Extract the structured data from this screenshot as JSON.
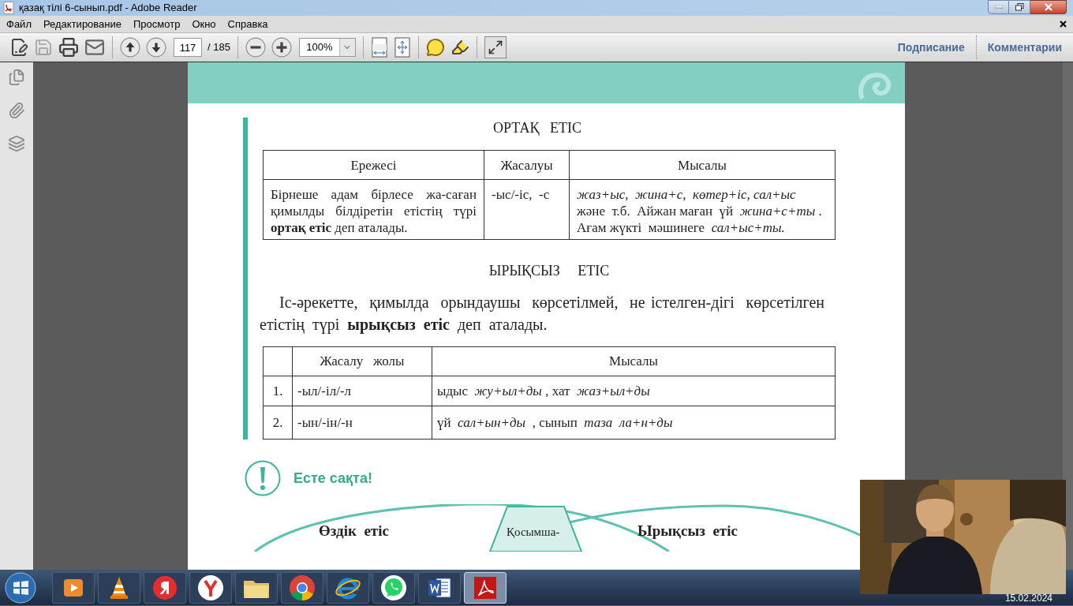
{
  "window": {
    "title": "қазақ тілі 6-сынып.pdf - Adobe Reader"
  },
  "menu": [
    "Файл",
    "Редактирование",
    "Просмотр",
    "Окно",
    "Справка"
  ],
  "toolbar": {
    "groups": [
      {
        "tools": [
          {
            "kind": "edit",
            "disabled": false
          },
          {
            "kind": "save",
            "disabled": true
          },
          {
            "kind": "print",
            "disabled": false
          },
          {
            "kind": "mail",
            "disabled": false
          }
        ]
      },
      {
        "tools": [
          {
            "kind": "up",
            "disabled": false
          },
          {
            "kind": "down",
            "disabled": false
          }
        ],
        "page": "117",
        "page_total": "/ 185"
      },
      {
        "tools": [
          {
            "kind": "zoom-out",
            "disabled": false
          },
          {
            "kind": "zoom-in",
            "disabled": false
          }
        ],
        "zoom": "100%"
      },
      {
        "tools": [
          {
            "kind": "fit-width",
            "disabled": false
          },
          {
            "kind": "fit-page",
            "disabled": false
          }
        ]
      },
      {
        "tools": [
          {
            "kind": "comment",
            "disabled": false
          },
          {
            "kind": "highlight",
            "disabled": false
          }
        ]
      },
      {
        "tools": [
          {
            "kind": "fullscreen",
            "disabled": false
          }
        ]
      }
    ],
    "links": [
      "Подписание",
      "Комментарии"
    ]
  },
  "document": {
    "heading1": "ОРТАҚ   ЕТІС",
    "table1": {
      "columns": [
        "Ережесі",
        "Жасалуы",
        "Мысалы"
      ],
      "rows": [
        [
          "Бірнеше адам бірлесе жа-саған қимылды білдіретін етістің түрі **ортақ етіс** деп аталады.",
          "-ыс/-іс,  -с",
          "*жаз+ыс,  жина+с,  көтер+іс, сал+ыс*  және  т.б.  Айжан маған  үй  *жина+с+ты* . Ағам жүкті  мәшинеге  *сал+ыс+ты.*"
        ]
      ]
    },
    "heading2": "ЫРЫҚСЫЗ     ЕТІС",
    "paragraph": "Іс-әрекетте,  қимылда  орындаушы  көрсетілмей,  не істелген-дігі  көрсетілген   етістің  түрі  **ырықсыз  етіс**  деп  аталады.",
    "table2": {
      "columns": [
        "",
        "Жасалу   жолы",
        "Мысалы"
      ],
      "rows": [
        [
          "1.",
          "-ыл/-іл/-л",
          "ыдыс  *жу+ыл+ды* , хат  *жаз+ыл+ды*"
        ],
        [
          "2.",
          "-ын/-ін/-н",
          "үй  *сал+ын+ды*  , сынып  *таза  ла+н+ды*"
        ]
      ]
    },
    "note": "Есте сақта!",
    "diagram": {
      "left": "Өздік  етіс",
      "center": "Қосымша-",
      "right": "Ырықсыз  етіс"
    }
  },
  "taskbar": {
    "apps": [
      {
        "kind": "media",
        "selected": false
      },
      {
        "kind": "vlc",
        "selected": false
      },
      {
        "kind": "yandex",
        "selected": false
      },
      {
        "kind": "yandex-browser",
        "selected": false
      },
      {
        "kind": "folder",
        "selected": false
      },
      {
        "kind": "chrome",
        "selected": false
      },
      {
        "kind": "ie",
        "selected": false
      },
      {
        "kind": "whatsapp",
        "selected": false
      },
      {
        "kind": "word",
        "selected": false
      },
      {
        "kind": "acrobat",
        "selected": true
      }
    ],
    "date": "15.02.2024"
  },
  "webcam": {
    "kind": "picture"
  }
}
